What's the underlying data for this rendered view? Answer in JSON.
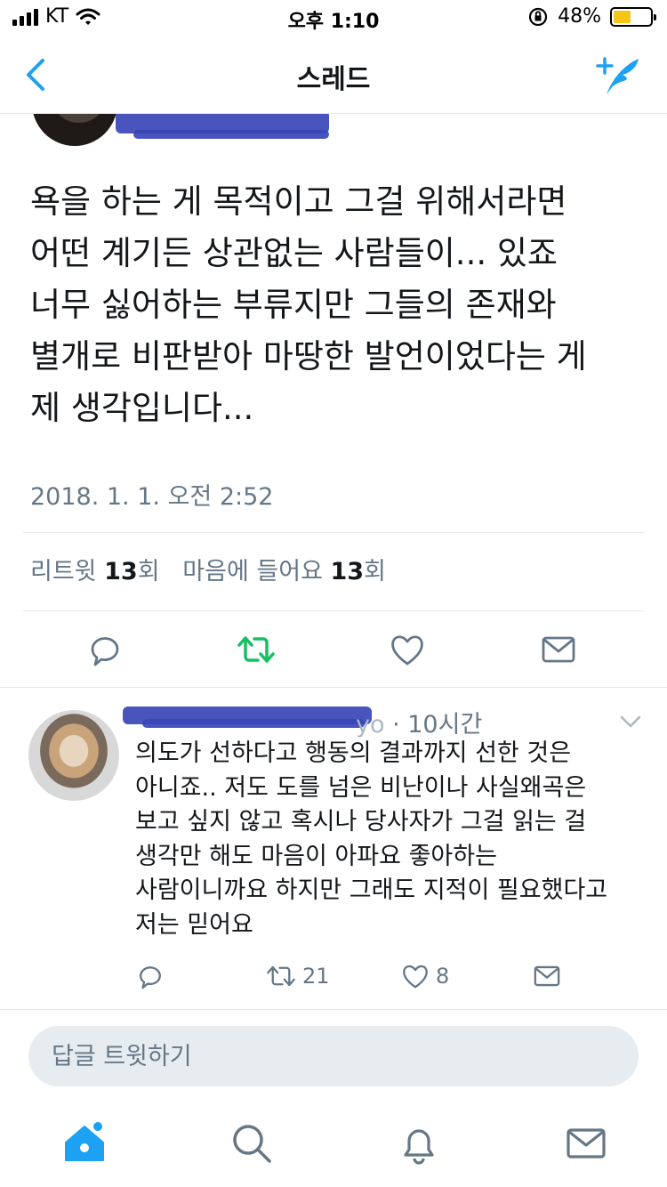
{
  "status_bar": {
    "carrier": "KT",
    "time": "오후 1:10",
    "battery": "48%"
  },
  "nav": {
    "title": "스레드"
  },
  "tweet": {
    "lines": [
      "욕을 하는 게 목적이고 그걸 위해서라면",
      "어떤 계기든 상관없는 사람들이... 있죠",
      "너무 싫어하는 부류지만 그들의 존재와",
      "별개로 비판받아 마땅한 발언이었다는 게",
      "제 생각입니다..."
    ],
    "timestamp": "2018. 1. 1. 오전 2:52",
    "retweet_label": "리트윗",
    "retweet_count": "13",
    "retweet_unit": "회",
    "like_label": "마음에 들어요",
    "like_count": "13",
    "like_unit": "회"
  },
  "reply": {
    "handle_tail": "yo",
    "time": "· 10시간",
    "lines": [
      "의도가 선하다고 행동의 결과까지 선한 것은",
      "아니죠.. 저도 도를 넘은 비난이나 사실왜곡은",
      "보고 싶지 않고 혹시나 당사자가 그걸 읽는 걸",
      "생각만 해도 마음이 아파요 좋아하는",
      "사람이니까요 하지만 그래도 지적이 필요했다고",
      "저는 믿어요"
    ],
    "retweet_count": "21",
    "like_count": "8"
  },
  "reply_box": {
    "placeholder": "답글 트윗하기"
  },
  "colors": {
    "accent": "#1da1f2",
    "retweet_green": "#17bf63",
    "muted": "#657786",
    "redaction": "#3a45b7"
  },
  "icons": [
    "back-icon",
    "compose-icon",
    "reply-icon",
    "retweet-icon",
    "heart-icon",
    "mail-icon",
    "chevron-down-icon",
    "home-icon",
    "search-icon",
    "bell-icon",
    "messages-icon"
  ]
}
